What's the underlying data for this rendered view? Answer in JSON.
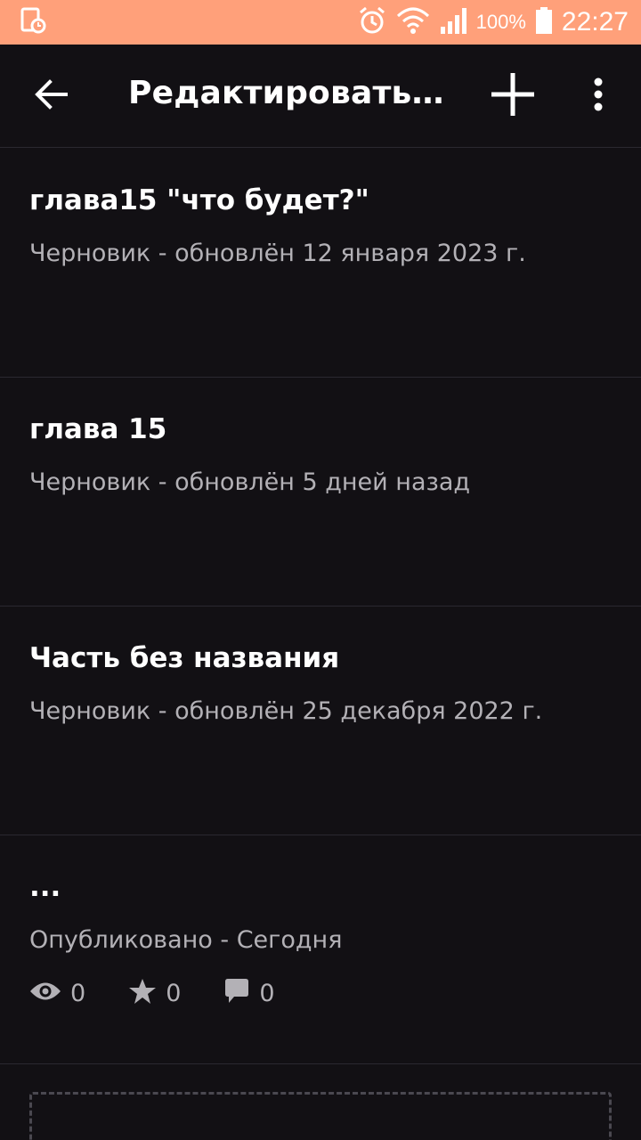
{
  "status_bar": {
    "battery_percent": "100%",
    "time": "22:27",
    "background_color": "#ffa07a",
    "icons": [
      "screen-record-icon",
      "alarm-icon",
      "wifi-icon",
      "signal-icon",
      "battery-icon"
    ]
  },
  "app_bar": {
    "title": "Редактировать и...",
    "icons": [
      "back-arrow-icon",
      "plus-icon",
      "more-vert-icon"
    ]
  },
  "parts": [
    {
      "title": "глава15 \"что будет?\"",
      "status": "Черновик - обновлён 12 января 2023 г."
    },
    {
      "title": "глава 15",
      "status": "Черновик - обновлён 5 дней назад"
    },
    {
      "title": "Часть без названия",
      "status": "Черновик - обновлён 25 декабря 2022 г."
    },
    {
      "title": "...",
      "status": "Опубликовано - Сегодня",
      "stats": {
        "views": "0",
        "votes": "0",
        "comments": "0"
      }
    }
  ],
  "colors": {
    "background": "#121014",
    "secondary_text": "#b3b1b6",
    "divider": "#2a2830"
  }
}
